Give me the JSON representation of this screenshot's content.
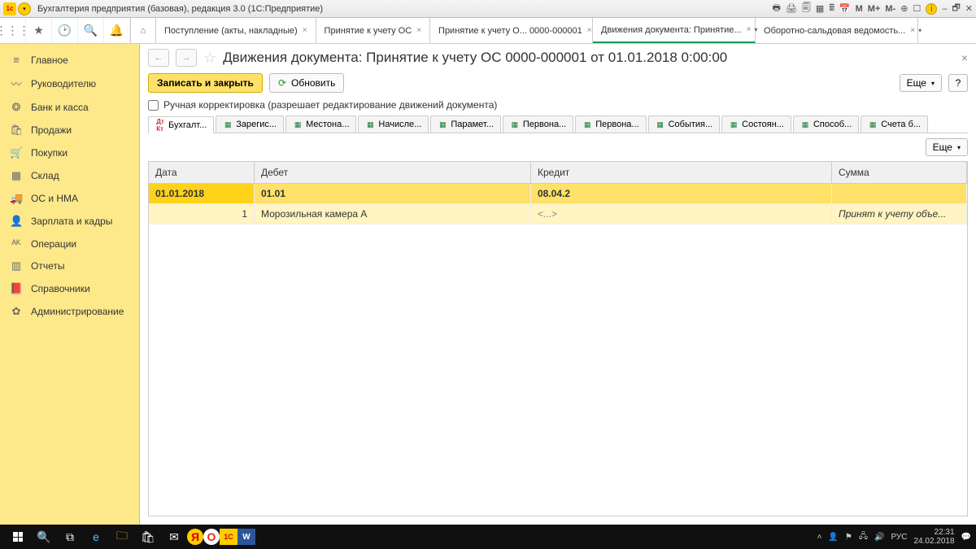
{
  "window": {
    "title": "Бухгалтерия предприятия (базовая), редакция 3.0  (1С:Предприятие)",
    "sys_icons": [
      "M",
      "M+",
      "M-"
    ]
  },
  "tabs": [
    {
      "label": "Поступление (акты, накладные)",
      "closable": true
    },
    {
      "label": "Принятие к учету ОС",
      "closable": true
    },
    {
      "label": "Принятие к учету О... 0000-000001",
      "closable": true
    },
    {
      "label": "Движения документа: Принятие...",
      "closable": true,
      "active": true,
      "caret": true
    },
    {
      "label": "Оборотно-сальдовая ведомость...",
      "closable": true,
      "caret": true
    }
  ],
  "sidebar": [
    {
      "icon": "≡",
      "label": "Главное"
    },
    {
      "icon": "〰",
      "label": "Руководителю"
    },
    {
      "icon": "❂",
      "label": "Банк и касса"
    },
    {
      "icon": "🛍",
      "label": "Продажи"
    },
    {
      "icon": "🛒",
      "label": "Покупки"
    },
    {
      "icon": "▦",
      "label": "Склад"
    },
    {
      "icon": "🚚",
      "label": "ОС и НМА"
    },
    {
      "icon": "👤",
      "label": "Зарплата и кадры"
    },
    {
      "icon": "ᴬᴷ",
      "label": "Операции"
    },
    {
      "icon": "▥",
      "label": "Отчеты"
    },
    {
      "icon": "📕",
      "label": "Справочники"
    },
    {
      "icon": "✿",
      "label": "Администрирование"
    }
  ],
  "document": {
    "title": "Движения документа: Принятие к учету ОС 0000-000001 от 01.01.2018 0:00:00",
    "save_close": "Записать и закрыть",
    "refresh": "Обновить",
    "more": "Еще",
    "help": "?",
    "manual_edit": "Ручная корректировка (разрешает редактирование движений документа)"
  },
  "subtabs": [
    {
      "label": "Бухгалт...",
      "active": true,
      "icon": "dk"
    },
    {
      "label": "Зарегис..."
    },
    {
      "label": "Местона..."
    },
    {
      "label": "Начисле..."
    },
    {
      "label": "Парамет..."
    },
    {
      "label": "Первона..."
    },
    {
      "label": "Первона..."
    },
    {
      "label": "События..."
    },
    {
      "label": "Состоян..."
    },
    {
      "label": "Способ..."
    },
    {
      "label": "Счета б..."
    }
  ],
  "grid": {
    "headers": {
      "c1": "Дата",
      "c2": "Дебет",
      "c3": "Кредит",
      "c4": "Сумма"
    },
    "rows": [
      {
        "c1": "01.01.2018",
        "c2": "01.01",
        "c3": "08.04.2",
        "c4": "",
        "cls": "sel1"
      },
      {
        "c1": "1",
        "c2": "Морозильная камера А",
        "c3": "<...>",
        "c4": "Принят к учету объе...",
        "cls": "sel2"
      }
    ]
  },
  "taskbar": {
    "lang": "РУС",
    "time": "22:31",
    "date": "24.02.2018"
  }
}
